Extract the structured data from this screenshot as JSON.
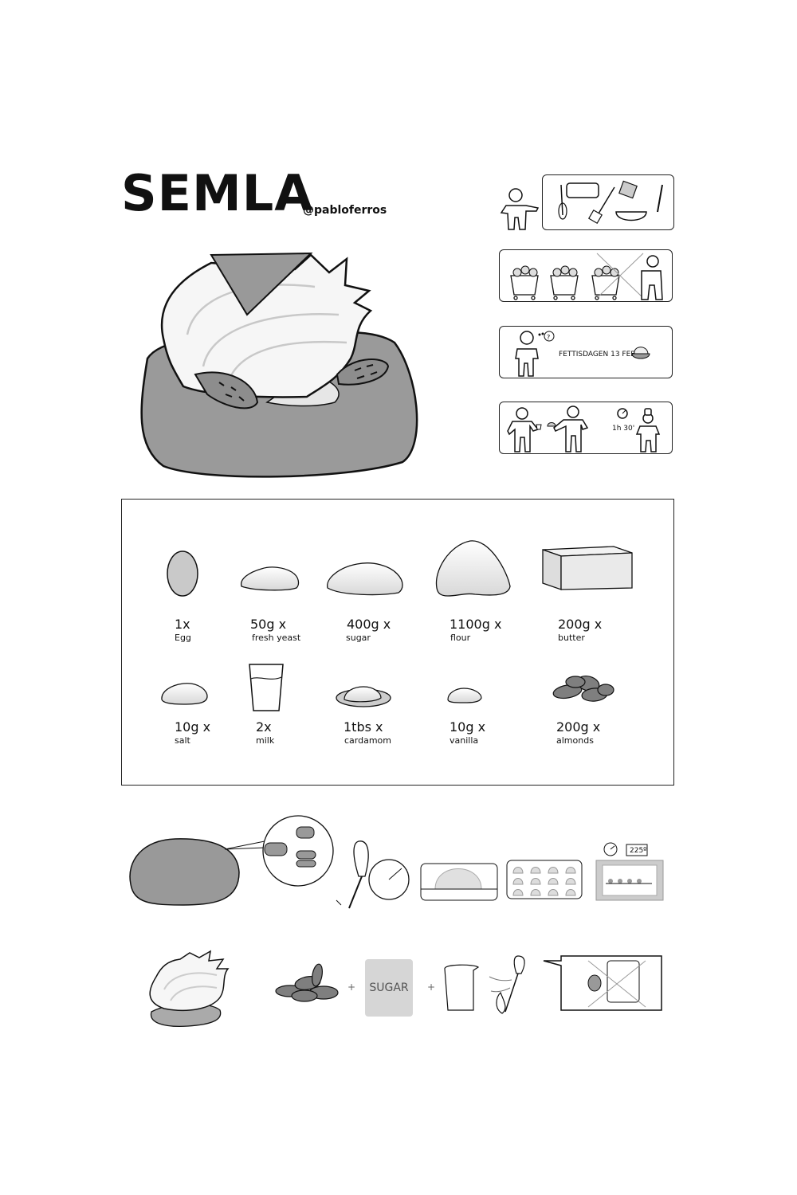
{
  "title": "SEMLA",
  "author": "@pabloferros",
  "steps": {
    "date_label": "FETTISDAGEN 13 FEB",
    "time_label": "1h 30'"
  },
  "ingredients": [
    {
      "qty": "1x",
      "name": "Egg"
    },
    {
      "qty": "50g x",
      "name": "fresh yeast"
    },
    {
      "qty": "400g x",
      "name": "sugar"
    },
    {
      "qty": "1100g x",
      "name": "flour"
    },
    {
      "qty": "200g x",
      "name": "butter"
    },
    {
      "qty": "10g x",
      "name": "salt"
    },
    {
      "qty": "2x",
      "name": "milk"
    },
    {
      "qty": "1tbs x",
      "name": "cardamom"
    },
    {
      "qty": "10g x",
      "name": "vanilla"
    },
    {
      "qty": "200g x",
      "name": "almonds"
    }
  ],
  "process": {
    "oven_temp": "225º",
    "sugar_label": "SUGAR",
    "plus": "+"
  },
  "colors": {
    "dark_gray": "#999999",
    "light_gray": "#d6d6d6",
    "outline": "#111111"
  }
}
